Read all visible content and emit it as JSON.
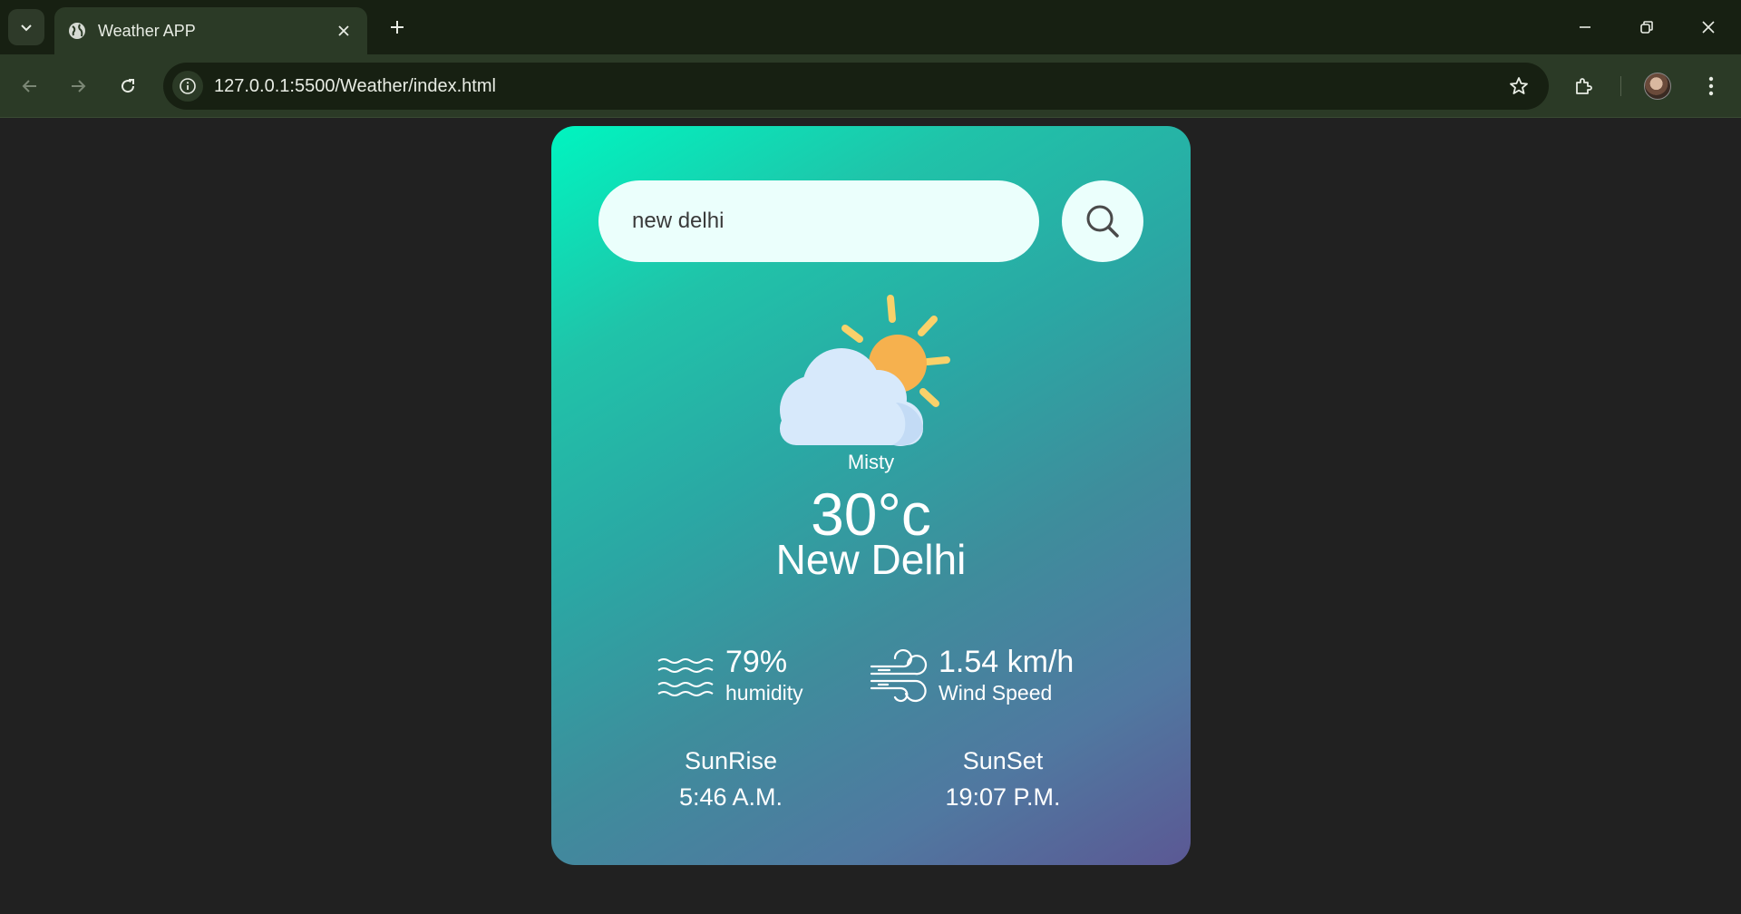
{
  "browser": {
    "tab_title": "Weather APP",
    "url": "127.0.0.1:5500/Weather/index.html"
  },
  "weather": {
    "search": {
      "value": "new delhi"
    },
    "condition": "Misty",
    "temperature": "30°c",
    "city": "New Delhi",
    "humidity": {
      "value": "79%",
      "label": "humidity"
    },
    "wind": {
      "value": "1.54 km/h",
      "label": "Wind Speed"
    },
    "sunrise": {
      "label": "SunRise",
      "time": "5:46 A.M."
    },
    "sunset": {
      "label": "SunSet",
      "time": "19:07 P.M."
    }
  },
  "icons": {
    "weather": "partly-cloudy-icon",
    "search": "search-icon",
    "humidity": "waves-icon",
    "wind": "wind-icon"
  },
  "colors": {
    "gradient_start": "#00f5c0",
    "gradient_end": "#5b5894",
    "page_background": "#212121",
    "input_background": "#ebfffc",
    "sun": "#f6b14e",
    "cloud": "#d7e9fb"
  }
}
